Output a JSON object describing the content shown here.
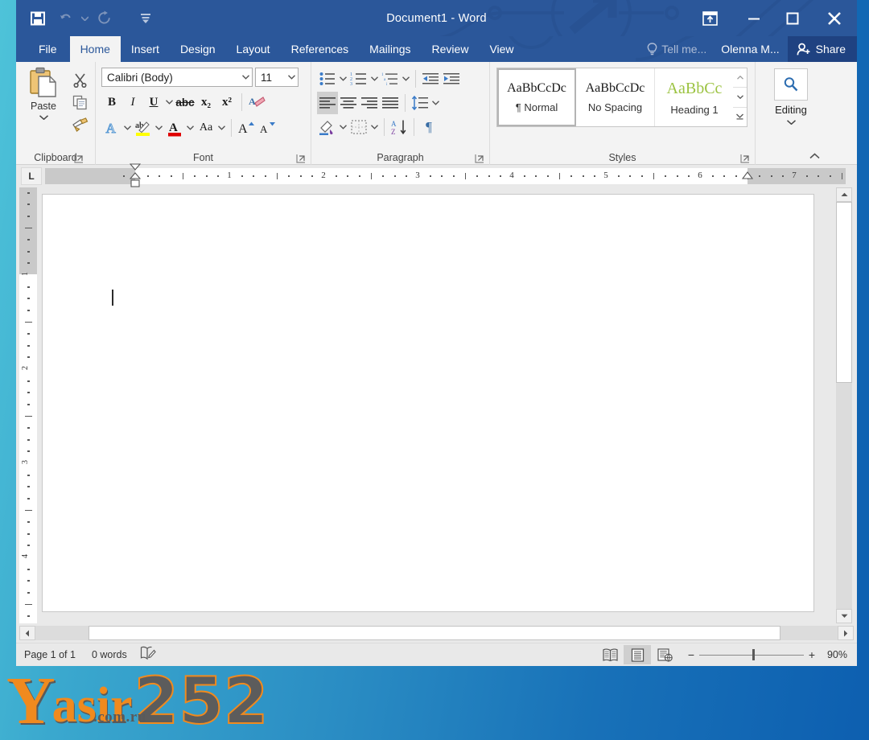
{
  "window": {
    "title": "Document1 - Word",
    "app": "Word"
  },
  "quick_access": {
    "save": "save-icon",
    "undo": "undo-icon",
    "redo": "redo-icon",
    "customize": "customize-qat-icon"
  },
  "window_controls": {
    "ribbon_display_options": "ribbon-display-options-icon",
    "minimize": "–",
    "restore": "❐",
    "close": "✕"
  },
  "tabs": [
    {
      "label": "File",
      "active": false
    },
    {
      "label": "Home",
      "active": true
    },
    {
      "label": "Insert",
      "active": false
    },
    {
      "label": "Design",
      "active": false
    },
    {
      "label": "Layout",
      "active": false
    },
    {
      "label": "References",
      "active": false
    },
    {
      "label": "Mailings",
      "active": false
    },
    {
      "label": "Review",
      "active": false
    },
    {
      "label": "View",
      "active": false
    }
  ],
  "tabstrip_right": {
    "tell_me": "Tell me...",
    "user_name": "Olenna M...",
    "share": "Share"
  },
  "ribbon": {
    "groups": [
      {
        "label": "Clipboard"
      },
      {
        "label": "Font"
      },
      {
        "label": "Paragraph"
      },
      {
        "label": "Styles"
      },
      {
        "label": "Editing"
      }
    ],
    "clipboard": {
      "paste_label": "Paste",
      "cut": "cut-scissors-icon",
      "copy": "copy-icon",
      "format_painter": "format-painter-icon"
    },
    "font": {
      "font_name": "Calibri (Body)",
      "font_size": "11",
      "bold": "B",
      "italic": "I",
      "underline": "U",
      "strikethrough": "abc",
      "subscript": "x₂",
      "superscript": "x²",
      "clear_formatting": "clear-formatting-icon",
      "text_effects": "A",
      "text_highlight": "highlight-icon",
      "font_color": "A",
      "change_case": "Aa",
      "grow_font": "A",
      "shrink_font": "A"
    },
    "paragraph": {
      "bullets": "bullets-icon",
      "numbering": "numbering-icon",
      "multilevel_list": "multilevel-list-icon",
      "decrease_indent": "decrease-indent-icon",
      "increase_indent": "increase-indent-icon",
      "align_left": "align-left-icon",
      "align_center": "align-center-icon",
      "align_right": "align-right-icon",
      "justify": "justify-icon",
      "line_spacing": "line-spacing-icon",
      "shading": "shading-icon",
      "borders": "borders-icon",
      "sort": "sort-icon",
      "show_marks": "¶"
    },
    "styles": [
      {
        "preview": "AaBbCcDc",
        "name": "¶ Normal",
        "selected": true
      },
      {
        "preview": "AaBbCcDc",
        "name": "No Spacing",
        "selected": false
      },
      {
        "preview": "AaBbCс",
        "name": "Heading 1",
        "selected": false
      }
    ],
    "editing": {
      "label": "Editing",
      "icon": "find-magnifier-icon"
    },
    "collapse_ribbon": "collapse-ribbon-icon"
  },
  "ruler": {
    "tab_stop": "L",
    "horizontal_numbers": [
      "1",
      "2",
      "3",
      "4",
      "5",
      "6",
      "7"
    ],
    "vertical_numbers": [
      "1",
      "2",
      "3"
    ]
  },
  "document": {
    "content": "",
    "caret_visible": true
  },
  "statusbar": {
    "page": "Page 1 of 1",
    "words": "0 words",
    "proofing": "proofing-icon",
    "views": [
      {
        "name": "read-mode",
        "active": false
      },
      {
        "name": "print-layout",
        "active": true
      },
      {
        "name": "web-layout",
        "active": false
      }
    ],
    "zoom_out": "−",
    "zoom_in": "+",
    "zoom_level": "90%"
  },
  "watermark": {
    "brand_y": "Y",
    "brand_asir": "asir",
    "brand_domain": ".com.ru",
    "brand_number": "252"
  },
  "colors": {
    "title_bar": "#2b579a",
    "share_bg": "#1f4281",
    "ribbon_bg": "#f3f3f3",
    "accent_orange": "#f08a1e",
    "heading_green": "#9cc342",
    "page_bg": "#e9e9e9",
    "bg_gradient_start": "#4ec3d9",
    "bg_gradient_end": "#0d5fb0"
  }
}
